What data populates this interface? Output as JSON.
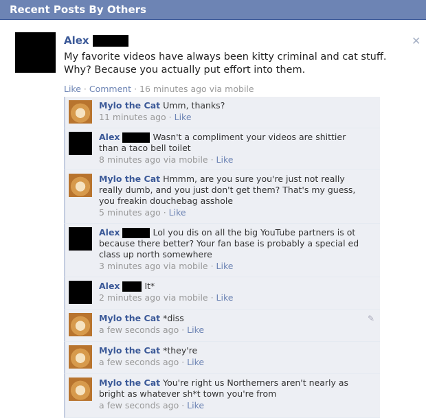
{
  "header": {
    "title": "Recent Posts By Others"
  },
  "post": {
    "author": "Alex",
    "text": "My favorite videos have always been kitty criminal and cat stuff. Why? Because you actually put effort into them.",
    "like": "Like",
    "comment": "Comment",
    "time": "16 minutes ago via mobile"
  },
  "comments": [
    {
      "author": "Mylo the Cat",
      "text": "Umm, thanks?",
      "time": "11 minutes ago",
      "like": "Like"
    },
    {
      "author": "Alex",
      "text": "Wasn't a compliment your videos are shittier than a taco bell toilet",
      "time": "8 minutes ago via mobile",
      "like": "Like"
    },
    {
      "author": "Mylo the Cat",
      "text": "Hmmm, are you sure you're just not really really dumb, and you just don't get them? That's my guess, you freakin douchebag asshole",
      "time": "5 minutes ago",
      "like": "Like"
    },
    {
      "author": "Alex",
      "text": "Lol you dis on all the big YouTube partners is ot because there better? Your fan base is probably a special ed class up north somewhere",
      "time": "3 minutes ago via mobile",
      "like": "Like"
    },
    {
      "author": "Alex",
      "text": "It*",
      "time": "2 minutes ago via mobile",
      "like": "Like"
    },
    {
      "author": "Mylo the Cat",
      "text": "*diss",
      "time": "a few seconds ago",
      "like": "Like"
    },
    {
      "author": "Mylo the Cat",
      "text": "*they're",
      "time": "a few seconds ago",
      "like": "Like"
    },
    {
      "author": "Mylo the Cat",
      "text": "You're right us Northerners aren't nearly as bright as whatever sh*t town you're from",
      "time": "a few seconds ago",
      "like": "Like"
    }
  ],
  "icons": {
    "close": "close-icon",
    "edit": "pencil-icon"
  }
}
